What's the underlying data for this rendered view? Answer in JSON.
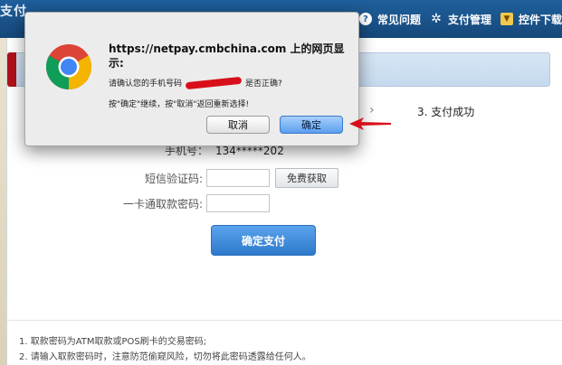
{
  "header": {
    "brand_text": "支付",
    "nav": [
      {
        "label": "常见问题",
        "icon": "help-icon"
      },
      {
        "label": "支付管理",
        "icon": "gear-icon"
      },
      {
        "label": "控件下载",
        "icon": "download-icon"
      }
    ]
  },
  "steps": {
    "step3_label": "3. 支付成功"
  },
  "form": {
    "phone_label": "手机号：",
    "phone_value": "134*****202",
    "sms_label": "短信验证码:",
    "sms_button": "免费获取",
    "password_label": "一卡通取款密码:",
    "submit_button": "确定支付"
  },
  "notes": [
    "1. 取款密码为ATM取款或POS刷卡的交易密码;",
    "2. 请输入取款密码时，注意防范偷窥风险，切勿将此密码透露给任何人。"
  ],
  "dialog": {
    "title": "https://netpay.cmbchina.com 上的网页显示:",
    "message_prefix": "请确认您的手机号码",
    "message_suffix": "是否正确?",
    "message_2": "按\"确定\"继续，按\"取消\"返回重新选择!",
    "cancel_label": "取消",
    "ok_label": "确定"
  },
  "colors": {
    "header_blue": "#1f5f9c",
    "accent_red": "#d80f1a",
    "primary_button": "#2e79cc"
  }
}
